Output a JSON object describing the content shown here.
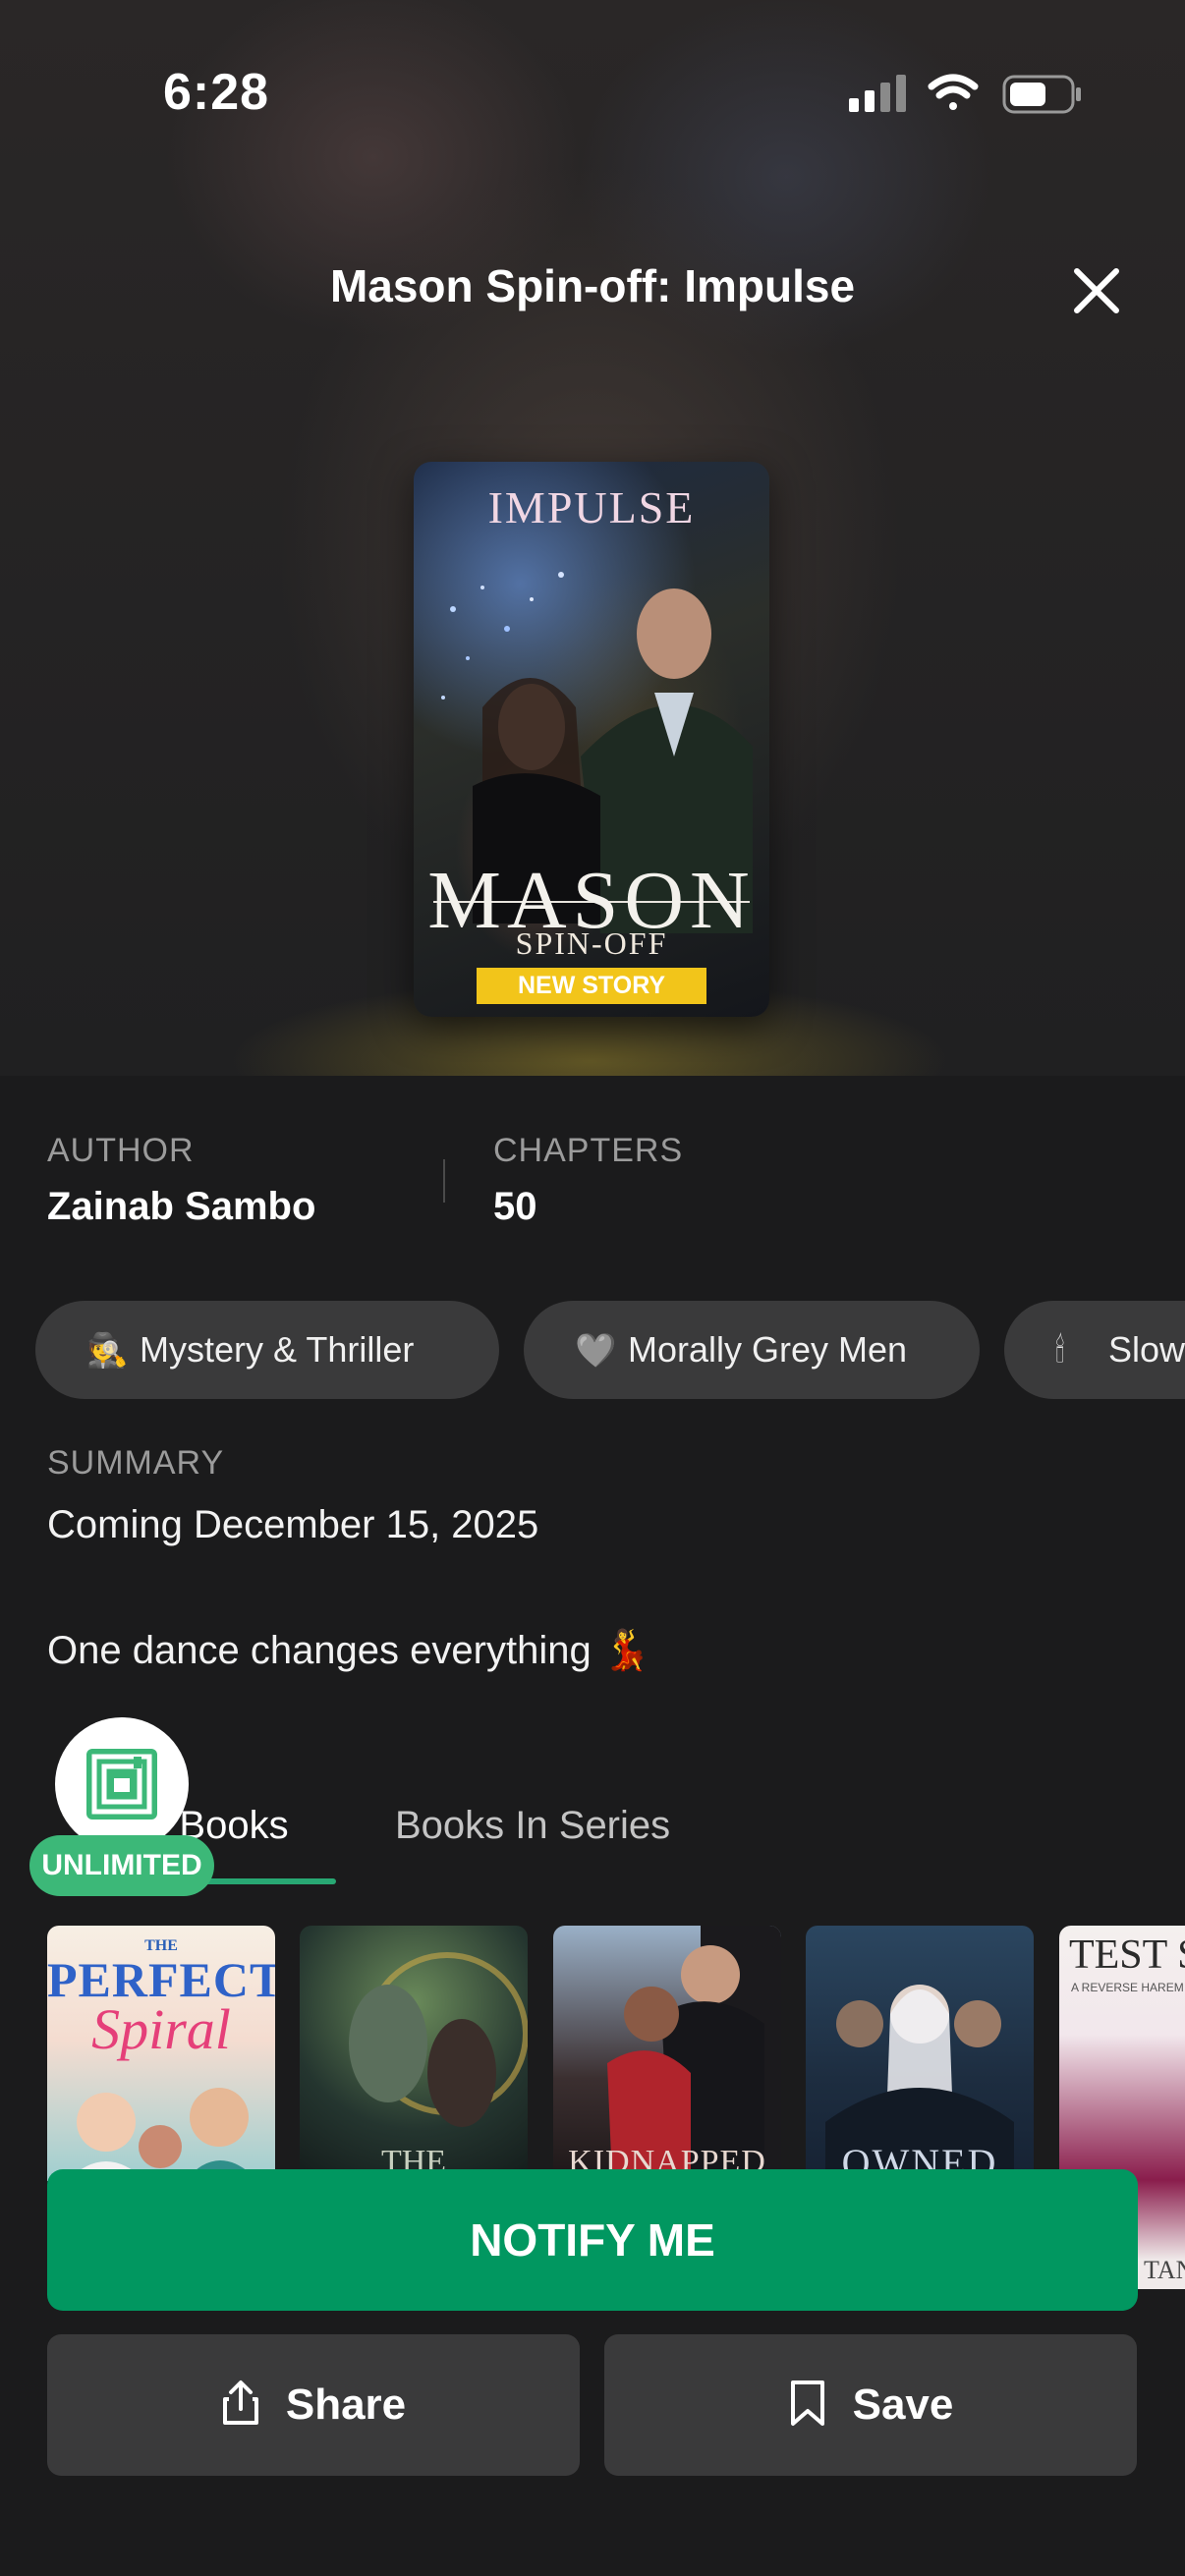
{
  "status_bar": {
    "time": "6:28"
  },
  "header": {
    "title": "Mason Spin-off: Impulse"
  },
  "cover": {
    "top_text": "IMPULSE",
    "name": "MASON",
    "subtitle": "SPIN-OFF",
    "badge": "NEW STORY"
  },
  "meta": {
    "author_label": "AUTHOR",
    "author": "Zainab Sambo",
    "chapters_label": "CHAPTERS",
    "chapters": "50"
  },
  "tags": [
    {
      "emoji": "🕵",
      "label": "Mystery & Thriller"
    },
    {
      "emoji": "🩶",
      "label": "Morally Grey Men"
    },
    {
      "emoji": "🕯",
      "label": "Slow"
    }
  ],
  "summary": {
    "label": "SUMMARY",
    "line1": "Coming December 15, 2025",
    "line2": "One dance changes everything 💃"
  },
  "tabs": {
    "similar": "r Books",
    "series": "Books In Series"
  },
  "badge": {
    "unlimited": "UNLIMITED"
  },
  "books": [
    {
      "title_top": "THE",
      "title_main": "PERFECT",
      "title_script": "Spiral"
    },
    {
      "title_main": "THE"
    },
    {
      "title_main": "KIDNAPPED"
    },
    {
      "title_main": "OWNED"
    },
    {
      "title_main": "TEST SU",
      "subtitle": "A REVERSE HAREM",
      "footer": "TAN"
    }
  ],
  "actions": {
    "notify": "NOTIFY ME",
    "share": "Share",
    "save": "Save"
  }
}
